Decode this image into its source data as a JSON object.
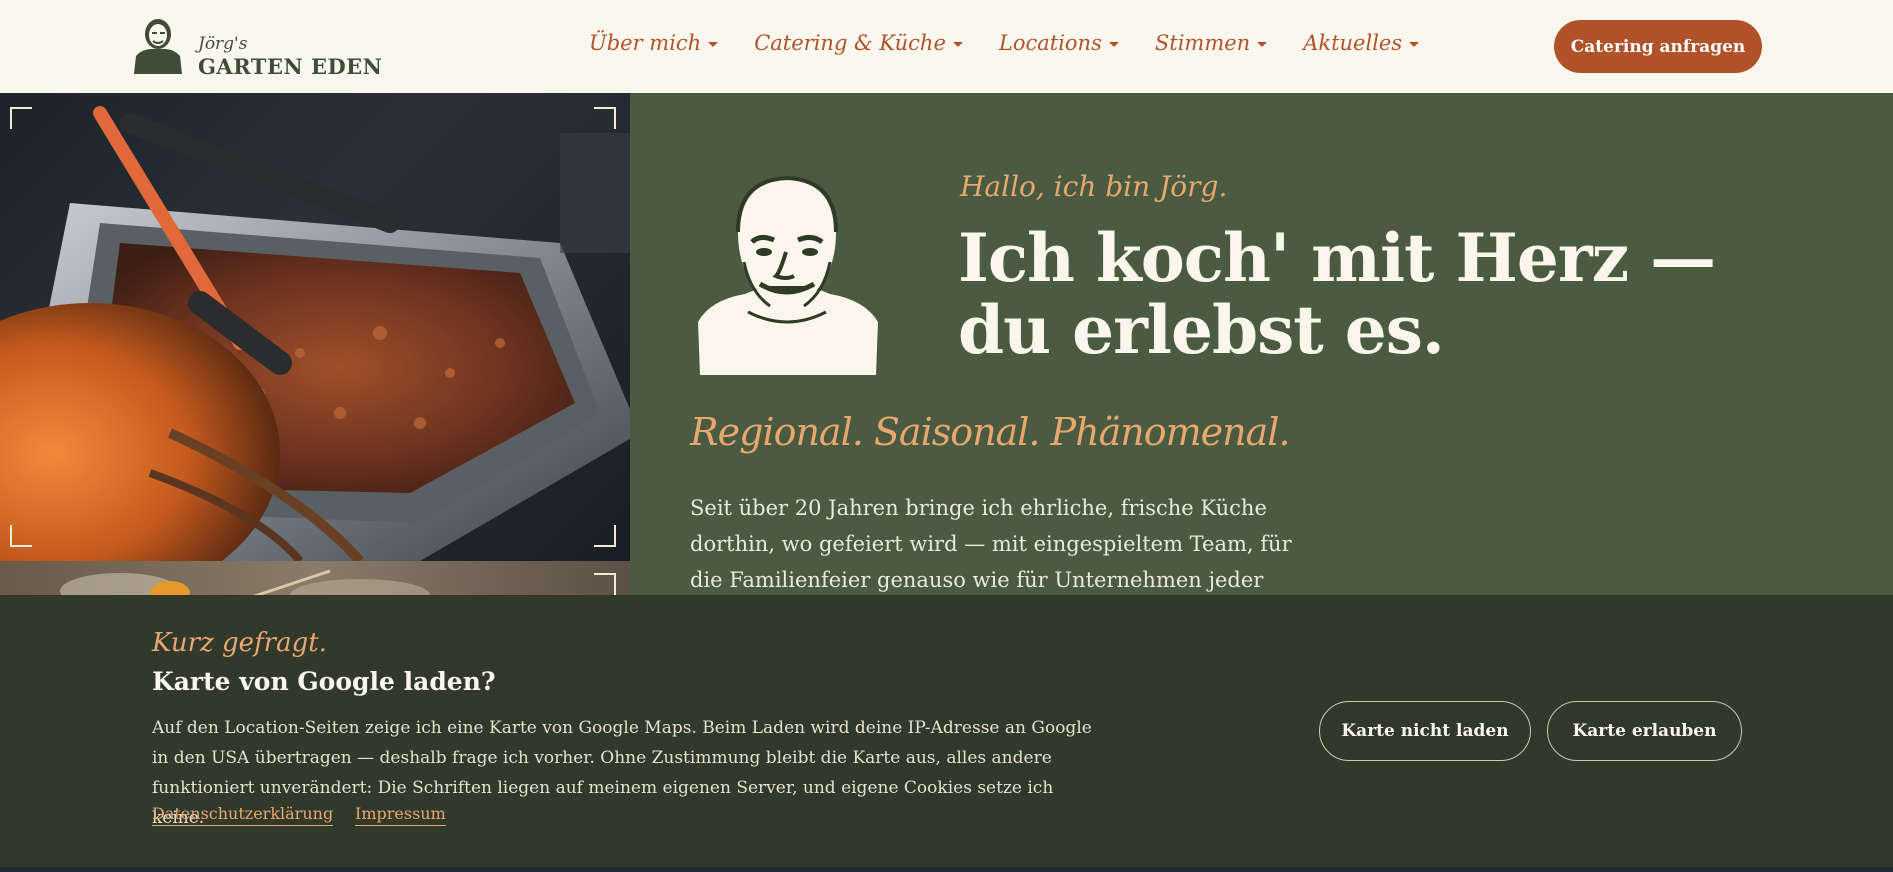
{
  "header": {
    "logo_small": "Jörg's",
    "logo_big": "GARTEN EDEN",
    "nav": [
      {
        "label": "Über mich"
      },
      {
        "label": "Catering & Küche"
      },
      {
        "label": "Locations"
      },
      {
        "label": "Stimmen"
      },
      {
        "label": "Aktuelles"
      }
    ],
    "cta_label": "Catering anfragen"
  },
  "hero": {
    "greeting": "Hallo, ich bin Jörg.",
    "headline": "Ich koch' mit Herz — du erlebst es.",
    "tagline": "Regional. Saisonal. Phänomenal.",
    "intro": "Seit über 20 Jahren bringe ich ehrliche, frische Küche dorthin, wo gefeiert wird — mit eingespieltem Team, für die Familienfeier genauso wie für Unternehmen jeder"
  },
  "consent": {
    "kicker": "Kurz gefragt.",
    "title": "Karte von Google laden?",
    "text": "Auf den Location-Seiten zeige ich eine Karte von Google Maps. Beim Laden wird deine IP-Adresse an Google in den USA übertragen — deshalb frage ich vorher. Ohne Zustimmung bleibt die Karte aus, alles andere funktioniert unverändert: Die Schriften liegen auf meinem eigenen Server, und eigene Cookies setze ich keine.",
    "privacy_link": "Datenschutzerklärung",
    "imprint_link": "Impressum",
    "decline_label": "Karte nicht laden",
    "accept_label": "Karte erlauben"
  },
  "colors": {
    "accent": "#b0532a",
    "hero_green": "#4a5b41",
    "banner_green": "#31392b",
    "peach": "#e8a76e",
    "cream": "#faf7ef"
  }
}
